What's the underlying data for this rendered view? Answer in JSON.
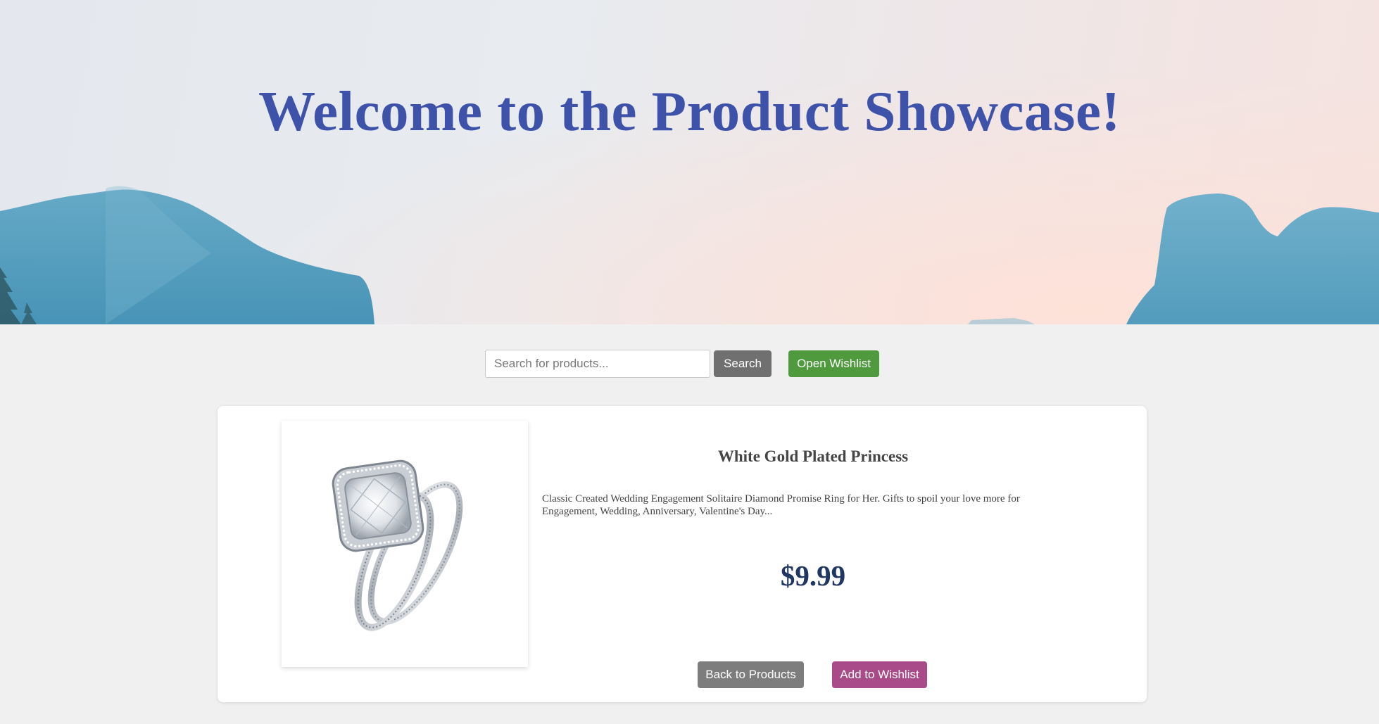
{
  "hero": {
    "title": "Welcome to the Product Showcase!"
  },
  "toolbar": {
    "search_placeholder": "Search for products...",
    "search_value": "",
    "search_button": "Search",
    "wishlist_button": "Open Wishlist"
  },
  "product": {
    "name": "White Gold Plated Princess",
    "description": "Classic Created Wedding Engagement Solitaire Diamond Promise Ring for Her. Gifts to spoil your love more for Engagement, Wedding, Anniversary, Valentine's Day...",
    "price": "$9.99",
    "image": "diamond-ring-image",
    "back_button": "Back to Products",
    "add_button": "Add to Wishlist"
  },
  "colors": {
    "title": "#3d52a8",
    "search_button": "#707070",
    "wishlist_button": "#4e9a3c",
    "back_button": "#7d7d7d",
    "add_button": "#a94b88",
    "price": "#1f3762"
  }
}
